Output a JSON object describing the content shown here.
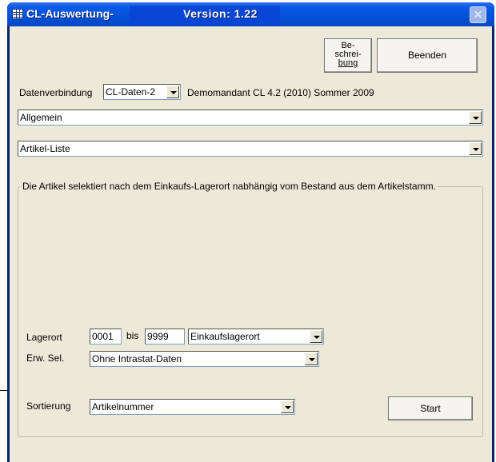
{
  "window": {
    "title": "CL-Auswertung-",
    "version": "Version: 1.22",
    "close_symbol": "✕"
  },
  "buttons": {
    "beschreibung": [
      "Be-",
      "schrei-",
      "bung"
    ],
    "beenden": "Beenden",
    "start": "Start"
  },
  "connection": {
    "label": "Datenverbindung",
    "value": "CL-Daten-2",
    "company": "Demomandant CL 4.2 (2010) Sommer 2009"
  },
  "category": {
    "value": "Allgemein"
  },
  "report": {
    "value": "Artikel-Liste"
  },
  "description": "Die Artikel selektiert nach dem Einkaufs-Lagerort nabhängig vom Bestand aus dem Artikelstamm.",
  "filters": {
    "lagerort_label": "Lagerort",
    "lagerort_from": "0001",
    "bis_label": "bis",
    "lagerort_to": "9999",
    "lagerort_type": "Einkaufslagerort",
    "erw_sel_label": "Erw. Sel.",
    "erw_sel_value": "Ohne Intrastat-Daten",
    "sortierung_label": "Sortierung",
    "sortierung_value": "Artikelnummer"
  },
  "icons": {
    "app": "table-icon",
    "dropdown": "chevron-down-icon",
    "close": "close-icon"
  }
}
